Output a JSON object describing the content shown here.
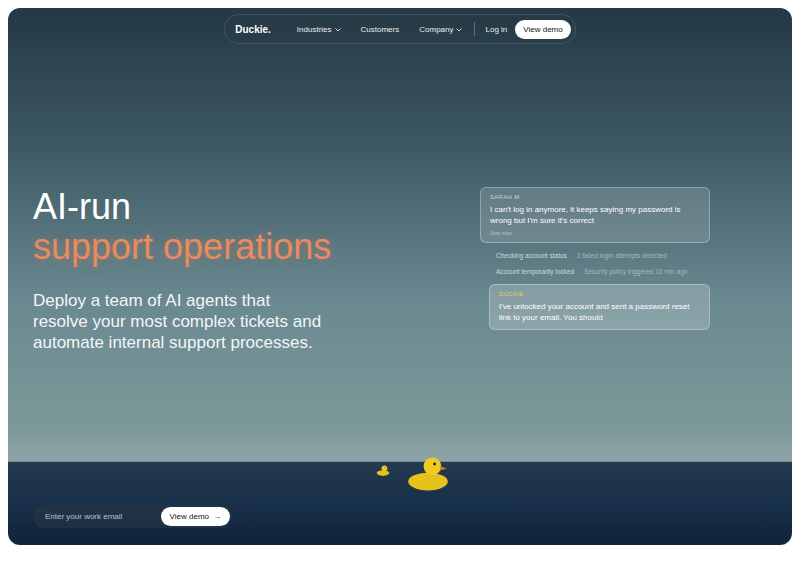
{
  "nav": {
    "logo": "Duckie.",
    "items": [
      {
        "label": "Industries",
        "dropdown": true
      },
      {
        "label": "Customers",
        "dropdown": false
      },
      {
        "label": "Company",
        "dropdown": true
      }
    ],
    "login": "Log in",
    "cta": "View demo"
  },
  "hero": {
    "title": "AI-run",
    "highlight": "support operations",
    "subtitle": "Deploy a team of AI agents that resolve your most complex tickets and automate internal support processes."
  },
  "chat": {
    "customer": {
      "name": "SARAH M",
      "message": "I can't log in anymore, it keeps saying my password is wrong but I'm sure it's correct",
      "time": "Just now"
    },
    "steps": [
      {
        "label": "Checking account status",
        "detail": "3 failed login attempts detected"
      },
      {
        "label": "Account temporarily locked",
        "detail": "Security policy triggered 10 min ago"
      }
    ],
    "agent": {
      "name": "DUCKIE",
      "message": "I've unlocked your account and sent a password reset link to your email. You should"
    }
  },
  "signup": {
    "placeholder": "Enter your work email",
    "button": "View demo",
    "arrow": "→"
  }
}
